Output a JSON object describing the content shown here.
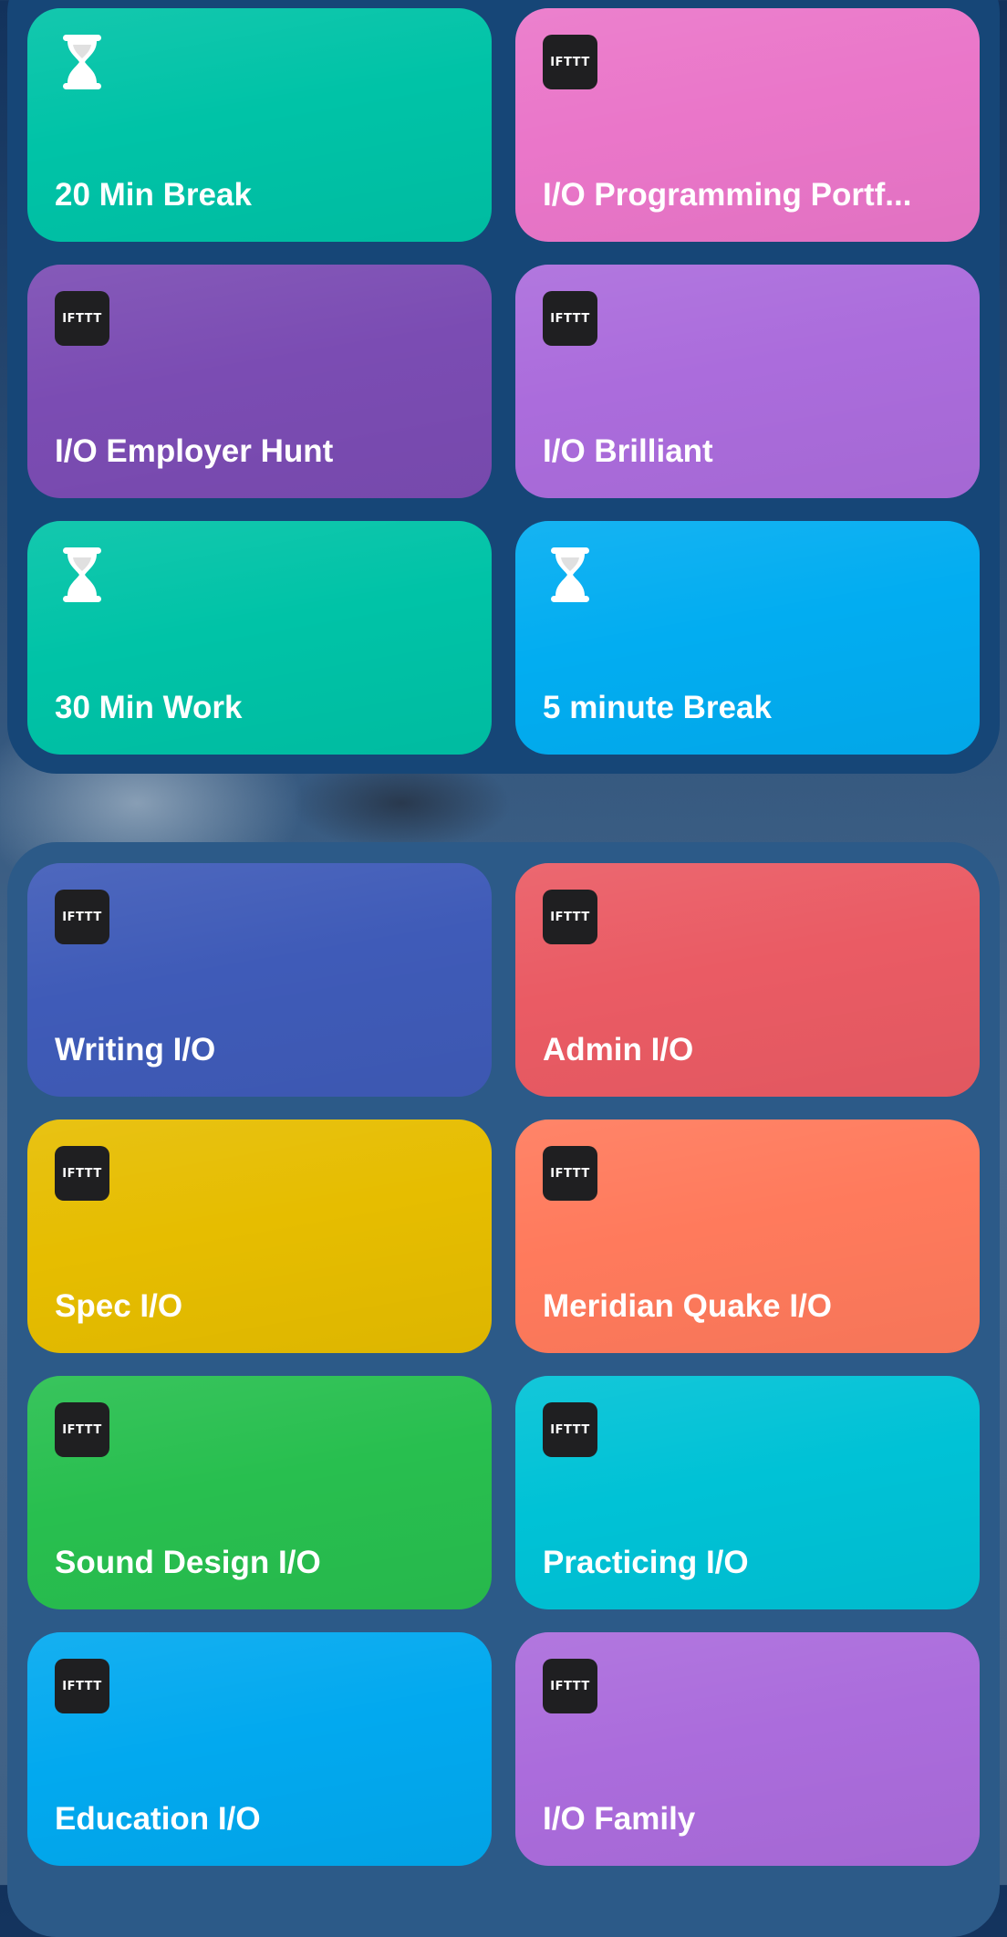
{
  "widgets": [
    {
      "tiles": [
        {
          "label": "20 Min Break",
          "icon": "hourglass-icon",
          "color": "#00c3a7"
        },
        {
          "label": "I/O Programming Portf...",
          "icon": "ifttt-icon",
          "color": "#ea76c9",
          "icon_text": "IFTTT"
        },
        {
          "label": "I/O Employer Hunt",
          "icon": "ifttt-icon",
          "color": "#7b4cb3",
          "icon_text": "IFTTT"
        },
        {
          "label": "I/O Brilliant",
          "icon": "ifttt-icon",
          "color": "#ab6cdc",
          "icon_text": "IFTTT"
        },
        {
          "label": "30 Min Work",
          "icon": "hourglass-icon",
          "color": "#00c3a7"
        },
        {
          "label": "5 minute Break",
          "icon": "hourglass-icon",
          "color": "#02adf1"
        }
      ]
    },
    {
      "tiles": [
        {
          "label": "Writing I/O",
          "icon": "ifttt-icon",
          "color": "#3f5bb8",
          "icon_text": "IFTTT"
        },
        {
          "label": "Admin I/O",
          "icon": "ifttt-icon",
          "color": "#ea5b64",
          "icon_text": "IFTTT"
        },
        {
          "label": "Spec I/O",
          "icon": "ifttt-icon",
          "color": "#e6bd00",
          "icon_text": "IFTTT"
        },
        {
          "label": "Meridian Quake I/O",
          "icon": "ifttt-icon",
          "color": "#ff7a5c",
          "icon_text": "IFTTT"
        },
        {
          "label": "Sound Design I/O",
          "icon": "ifttt-icon",
          "color": "#28bf4f",
          "icon_text": "IFTTT"
        },
        {
          "label": "Practicing I/O",
          "icon": "ifttt-icon",
          "color": "#00c2d6",
          "icon_text": "IFTTT"
        },
        {
          "label": "Education I/O",
          "icon": "ifttt-icon",
          "color": "#02a9ef",
          "icon_text": "IFTTT"
        },
        {
          "label": "I/O Family",
          "icon": "ifttt-icon",
          "color": "#ab6cdc",
          "icon_text": "IFTTT"
        }
      ]
    }
  ]
}
